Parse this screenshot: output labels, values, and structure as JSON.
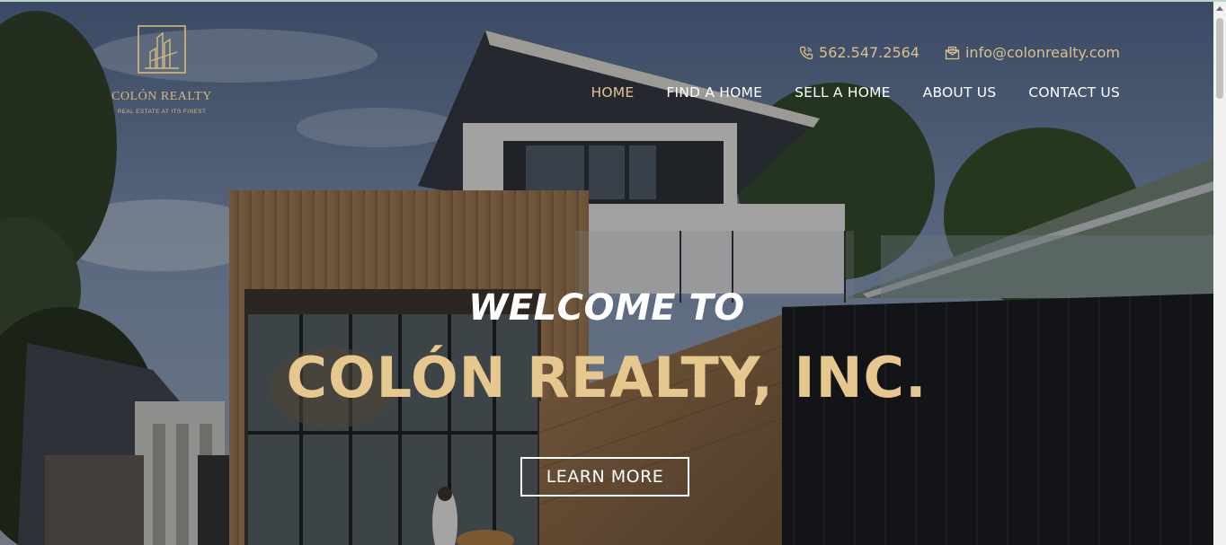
{
  "logo": {
    "name": "COLÓN REALTY",
    "tagline": "REAL ESTATE AT ITS FINEST"
  },
  "contact": {
    "phone": "562.547.2564",
    "email": "info@colonrealty.com"
  },
  "nav": {
    "items": [
      {
        "label": "HOME",
        "active": true
      },
      {
        "label": "FIND A HOME"
      },
      {
        "label": "SELL A HOME"
      },
      {
        "label": "ABOUT US"
      },
      {
        "label": "CONTACT US"
      }
    ]
  },
  "hero": {
    "welcome": "WELCOME TO",
    "brand": "COLÓN REALTY, INC.",
    "cta_label": "LEARN MORE"
  },
  "colors": {
    "accent_gold": "#e6c88e",
    "nav_text": "#ffffff"
  }
}
